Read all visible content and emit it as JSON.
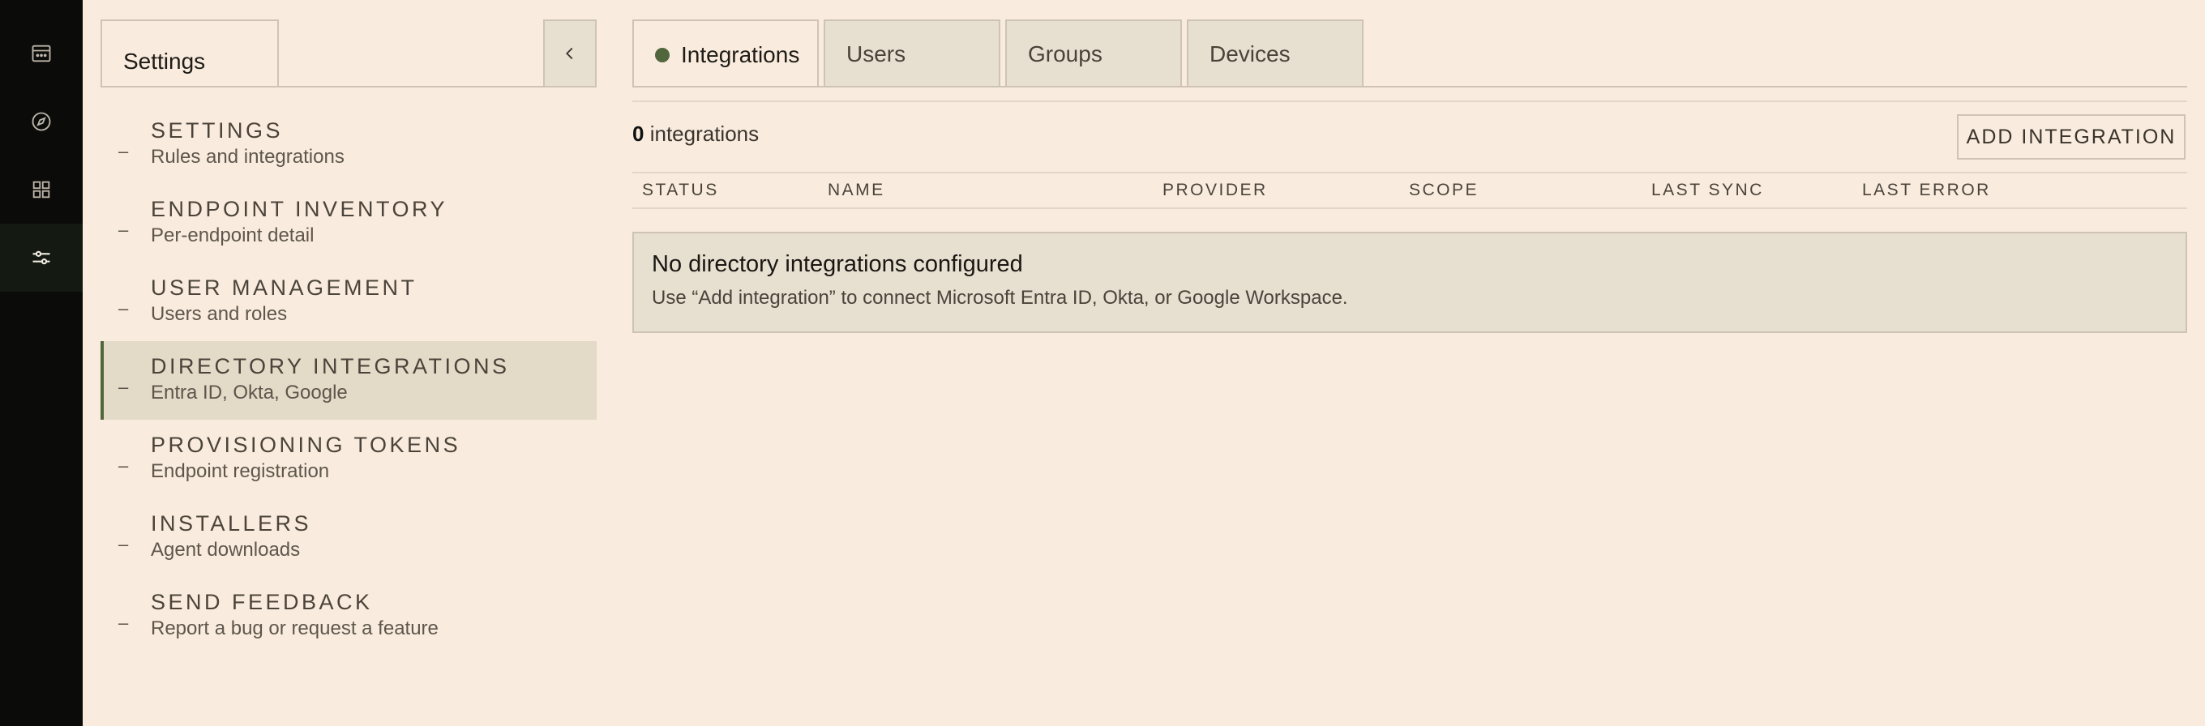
{
  "rail": {
    "items": [
      {
        "icon": "calendar-icon",
        "active": false
      },
      {
        "icon": "compass-icon",
        "active": false
      },
      {
        "icon": "grid-icon",
        "active": false
      },
      {
        "icon": "sliders-icon",
        "active": true
      }
    ]
  },
  "panel": {
    "tab_label": "Settings",
    "nav": [
      {
        "title": "SETTINGS",
        "subtitle": "Rules and integrations",
        "active": false
      },
      {
        "title": "ENDPOINT INVENTORY",
        "subtitle": "Per-endpoint detail",
        "active": false
      },
      {
        "title": "USER MANAGEMENT",
        "subtitle": "Users and roles",
        "active": false
      },
      {
        "title": "DIRECTORY INTEGRATIONS",
        "subtitle": "Entra ID, Okta, Google",
        "active": true
      },
      {
        "title": "PROVISIONING TOKENS",
        "subtitle": "Endpoint registration",
        "active": false
      },
      {
        "title": "INSTALLERS",
        "subtitle": "Agent downloads",
        "active": false
      },
      {
        "title": "SEND FEEDBACK",
        "subtitle": "Report a bug or request a feature",
        "active": false
      }
    ],
    "dash": "–"
  },
  "main": {
    "tabs": [
      {
        "label": "Integrations",
        "active": true
      },
      {
        "label": "Users",
        "active": false
      },
      {
        "label": "Groups",
        "active": false
      },
      {
        "label": "Devices",
        "active": false
      }
    ],
    "count_value": "0",
    "count_label": "integrations",
    "add_button": "ADD INTEGRATION",
    "columns": [
      "STATUS",
      "NAME",
      "PROVIDER",
      "SCOPE",
      "LAST SYNC",
      "LAST ERROR"
    ],
    "empty_title": "No directory integrations configured",
    "empty_desc": "Use “Add integration” to connect Microsoft Entra ID, Okta, or Google Workspace."
  },
  "colors": {
    "background": "#f9ecde",
    "rail": "#0b0b0a",
    "accent": "#52663d",
    "border": "#cfc4b3"
  }
}
